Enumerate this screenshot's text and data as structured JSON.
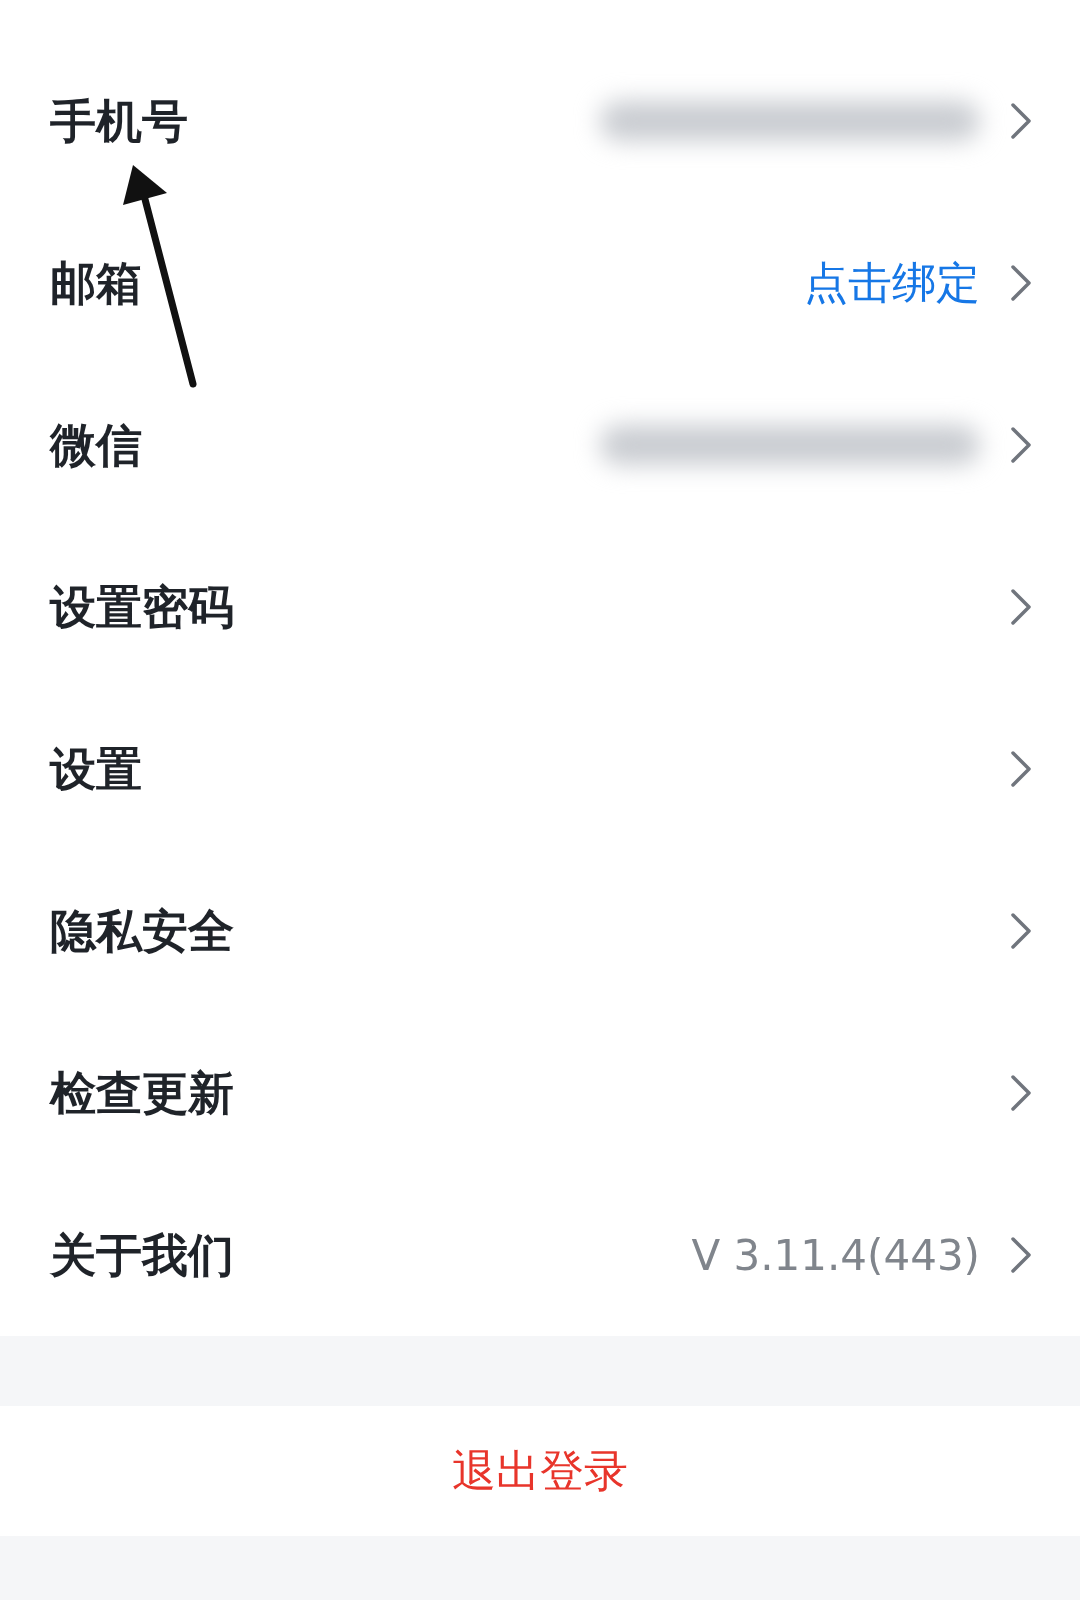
{
  "rows": [
    {
      "label": "手机号",
      "kind": "blurred"
    },
    {
      "label": "邮箱",
      "kind": "link",
      "value": "点击绑定"
    },
    {
      "label": "微信",
      "kind": "blurred"
    },
    {
      "label": "设置密码"
    },
    {
      "label": "设置"
    },
    {
      "label": "隐私安全"
    },
    {
      "label": "检查更新"
    },
    {
      "label": "关于我们",
      "kind": "version",
      "value": "V 3.11.4(443)"
    }
  ],
  "logout_button": "退出登录"
}
